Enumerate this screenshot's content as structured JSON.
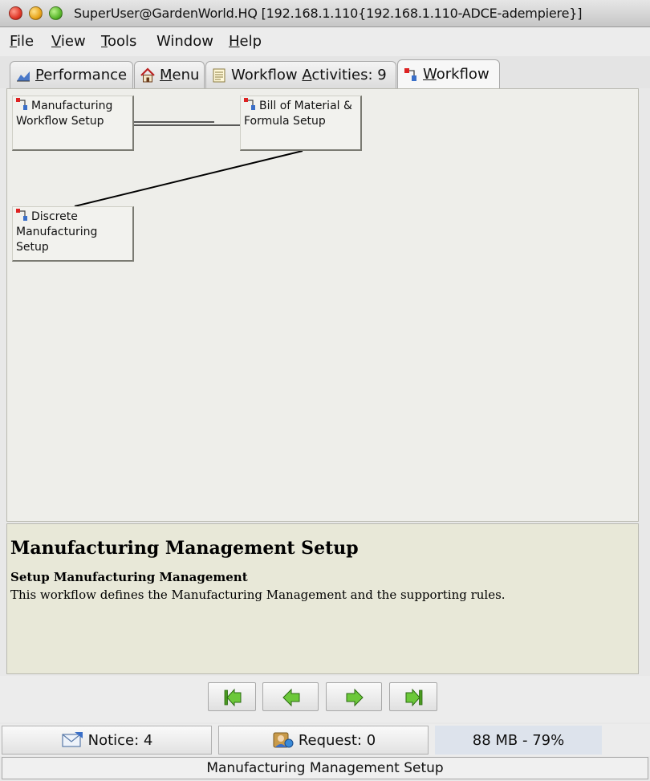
{
  "window": {
    "title": "SuperUser@GardenWorld.HQ [192.168.1.110{192.168.1.110-ADCE-adempiere}]"
  },
  "menubar": {
    "items": [
      {
        "mnemonic": "F",
        "rest": "ile"
      },
      {
        "mnemonic": "V",
        "rest": "iew"
      },
      {
        "mnemonic": "T",
        "rest": "ools"
      },
      {
        "mnemonic": "",
        "rest": "Window"
      },
      {
        "mnemonic": "H",
        "rest": "elp"
      }
    ]
  },
  "tabs": [
    {
      "mnemonic": "P",
      "rest": "erformance",
      "icon": "chart-icon"
    },
    {
      "mnemonic": "M",
      "rest": "enu",
      "icon": "home-icon"
    },
    {
      "pre": "Workflow ",
      "mnemonic": "A",
      "rest": "ctivities: 9",
      "icon": "activities-icon"
    },
    {
      "mnemonic": "W",
      "rest": "orkflow",
      "icon": "workflow-icon",
      "active": true
    }
  ],
  "workflow": {
    "nodes": [
      {
        "line1": "Manufacturing",
        "line2": "Workflow Setup",
        "line3": ""
      },
      {
        "line1": "Bill of Material &",
        "line2": "Formula Setup",
        "line3": ""
      },
      {
        "line1": "Discrete",
        "line2": "Manufacturing",
        "line3": "Setup"
      }
    ]
  },
  "description": {
    "title": "Manufacturing Management Setup",
    "subtitle": "Setup Manufacturing Management",
    "text": "This workflow defines the Manufacturing Management and the supporting rules."
  },
  "navigation": {
    "buttons": [
      "first-icon",
      "previous-icon",
      "next-icon",
      "last-icon"
    ]
  },
  "status": {
    "notice_label": "Notice: 4",
    "request_label": "Request: 0",
    "memory_label": "88 MB - 79%",
    "footer_text": "Manufacturing Management Setup"
  },
  "colors": {
    "nav_arrow_green": "#5cb82e",
    "description_bg": "#e8e8d8",
    "memory_bg": "#dde3ec"
  }
}
